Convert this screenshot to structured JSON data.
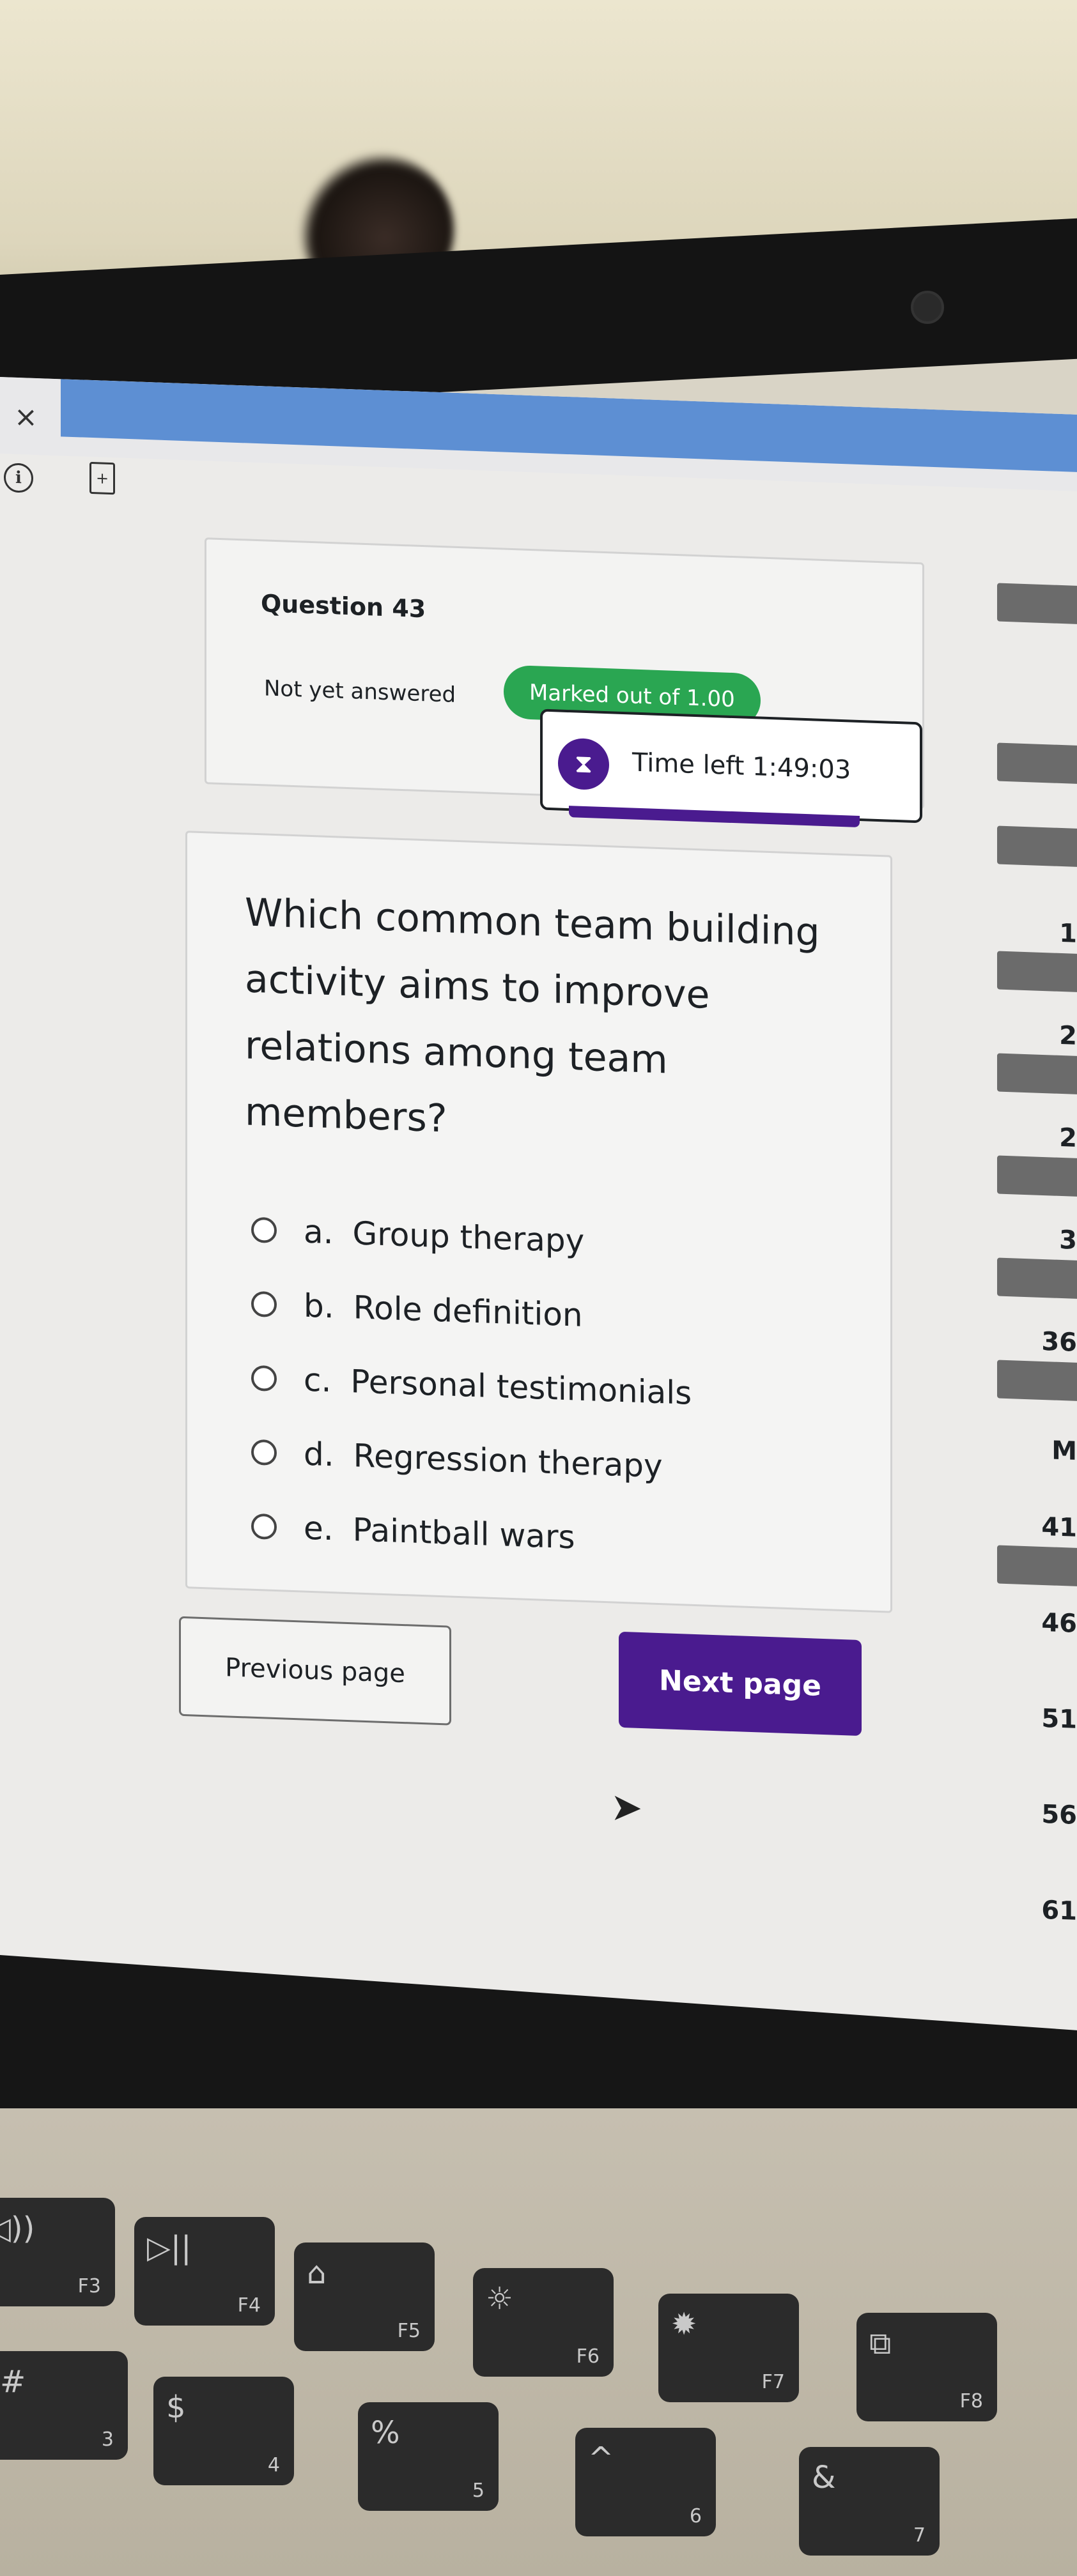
{
  "window": {
    "close_symbol": "×"
  },
  "toolbar": {
    "info_icon": "info-icon",
    "doc_icon": "document-icon"
  },
  "quiz": {
    "question_number": "Question 43",
    "status": "Not yet answered",
    "marks": "Marked out of 1.00",
    "timer": {
      "icon": "hourglass-icon",
      "label": "Time left 1:49:03"
    },
    "question_text": "Which common team building activity aims to improve relations among team members?",
    "options": [
      {
        "letter": "a.",
        "text": "Group therapy"
      },
      {
        "letter": "b.",
        "text": "Role definition"
      },
      {
        "letter": "c.",
        "text": "Personal testimonials"
      },
      {
        "letter": "d.",
        "text": "Regression therapy"
      },
      {
        "letter": "e.",
        "text": "Paintball wars"
      }
    ],
    "prev_label": "Previous page",
    "next_label": "Next page"
  },
  "navigation": {
    "visible_numbers": [
      "1",
      "2",
      "2",
      "3",
      "36",
      "M",
      "41",
      "46",
      "51",
      "56",
      "61"
    ]
  },
  "keyboard": {
    "keys": [
      {
        "symbol": "◁))",
        "label": "F3"
      },
      {
        "symbol": "▷||",
        "label": "F4"
      },
      {
        "symbol": "⌂",
        "label": "F5"
      },
      {
        "symbol": "☼",
        "label": "F6"
      },
      {
        "symbol": "✹",
        "label": "F7"
      },
      {
        "symbol": "⧉",
        "label": "F8"
      }
    ],
    "row2": [
      {
        "symbol": "#",
        "label": "3"
      },
      {
        "symbol": "$",
        "label": "4"
      },
      {
        "symbol": "%",
        "label": "5"
      },
      {
        "symbol": "^",
        "label": "6"
      },
      {
        "symbol": "&",
        "label": "7"
      }
    ]
  },
  "colors": {
    "accent_purple": "#4a1b8f",
    "badge_green": "#2aa652",
    "nav_gray": "#6b6b6b"
  }
}
